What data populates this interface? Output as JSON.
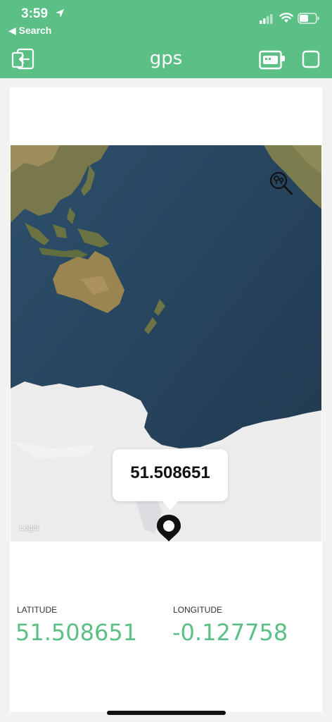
{
  "status_bar": {
    "time": "3:59",
    "back_app": "◀ Search"
  },
  "nav": {
    "title": "gps"
  },
  "map": {
    "callout_value": "51.508651",
    "legal_label": "Legal"
  },
  "latitude": {
    "label": "LATITUDE",
    "value": "51.508651"
  },
  "longitude": {
    "label": "LONGITUDE",
    "value": "-0.127758"
  },
  "colors": {
    "accent": "#5bbf86",
    "ocean": "#2b4a63",
    "ice": "#ececec",
    "land": "#8a7f4e"
  }
}
